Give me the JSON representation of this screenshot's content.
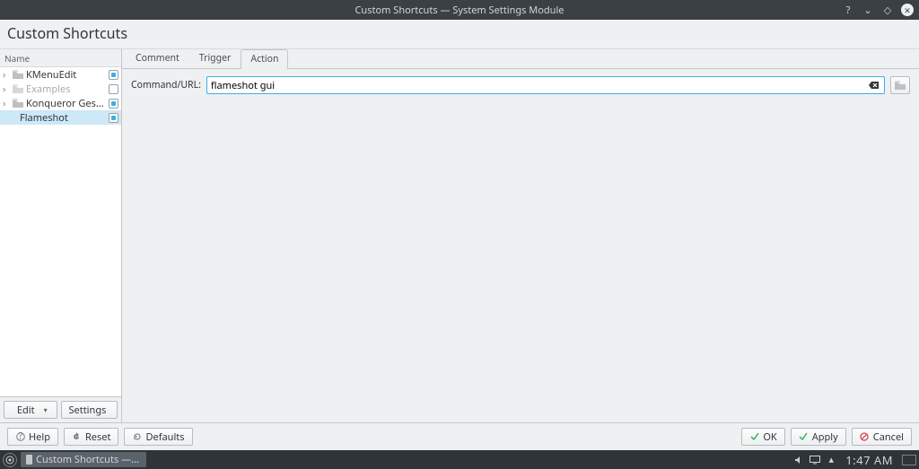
{
  "window": {
    "title": "Custom Shortcuts — System Settings Module",
    "heading": "Custom Shortcuts"
  },
  "tree": {
    "header": "Name",
    "items": [
      {
        "label": "KMenuEdit",
        "checked": true,
        "folder": true,
        "expandable": true,
        "disabled": false
      },
      {
        "label": "Examples",
        "checked": false,
        "folder": true,
        "expandable": true,
        "disabled": true
      },
      {
        "label": "Konqueror Gestures",
        "checked": true,
        "folder": true,
        "expandable": true,
        "disabled": false
      },
      {
        "label": "Flameshot",
        "checked": true,
        "folder": false,
        "expandable": false,
        "disabled": false,
        "selected": true
      }
    ]
  },
  "sidebar_buttons": {
    "edit": "Edit",
    "settings": "Settings"
  },
  "tabs": {
    "comment": "Comment",
    "trigger": "Trigger",
    "action": "Action",
    "active": "action"
  },
  "action_form": {
    "command_label": "Command/URL:",
    "command_value": "flameshot gui"
  },
  "footer": {
    "help": "Help",
    "reset": "Reset",
    "defaults": "Defaults",
    "ok": "OK",
    "apply": "Apply",
    "cancel": "Cancel"
  },
  "taskbar": {
    "task_title": "Custom Shortcuts — System Setti…",
    "clock": "1:47 AM"
  }
}
